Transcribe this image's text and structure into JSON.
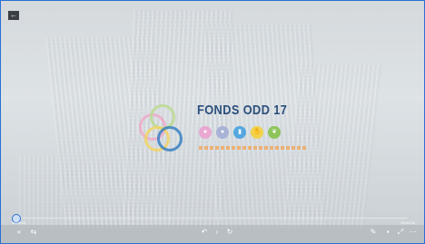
{
  "player": {
    "back_icon": "back-arrow-icon",
    "time_current": "00:00:01",
    "time_total": "00:04:25",
    "progress_fraction": 0.01
  },
  "slide": {
    "title": "FONDS ODD 17",
    "badges": [
      {
        "icon": "person-icon",
        "color": "#e9a7d2"
      },
      {
        "icon": "people-icon",
        "color": "#a8b3d6"
      },
      {
        "icon": "chart-icon",
        "color": "#55a7e0"
      },
      {
        "icon": "hand-icon",
        "color": "#f2d24b"
      },
      {
        "icon": "leaf-icon",
        "color": "#8fc45a"
      }
    ]
  },
  "controls": {
    "left": [
      "rewind-icon",
      "loop-icon"
    ],
    "center": [
      "prev-icon",
      "next-icon",
      "replay-icon"
    ],
    "right": [
      "edit-icon",
      "captions-icon",
      "fullscreen-icon",
      "more-icon"
    ]
  },
  "colors": {
    "accent": "#2a6fd6",
    "title": "#2b4f7b"
  }
}
